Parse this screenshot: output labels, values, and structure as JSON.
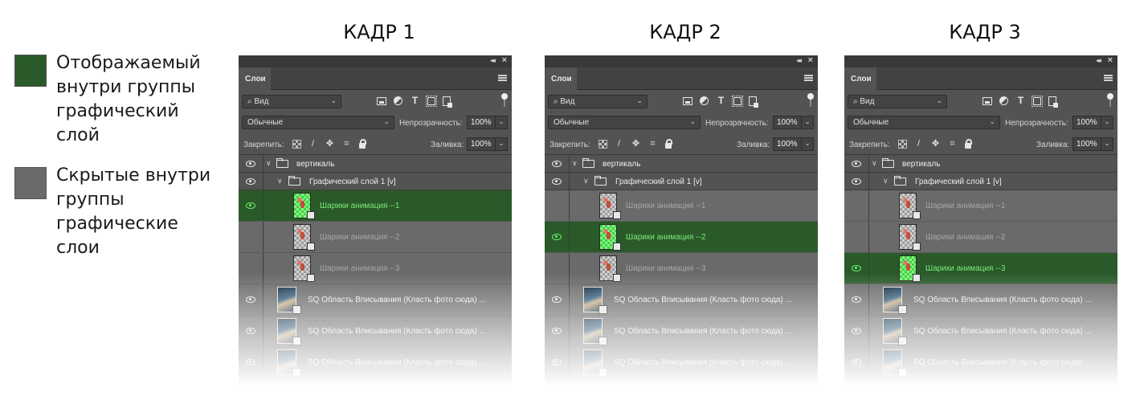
{
  "legend": {
    "items": [
      {
        "color": "#2a5a2a",
        "text": "Отображаемый внутри группы графический слой"
      },
      {
        "color": "#6a6a6a",
        "text": "Скрытые внутри группы графические слои"
      }
    ]
  },
  "frames": [
    {
      "title": "КАДР 1",
      "panel": {
        "tab": "Слои",
        "filter": "Вид",
        "blend": "Обычные",
        "opacity_label": "Непрозрачность:",
        "opacity": "100%",
        "lock_label": "Закрепить:",
        "fill_label": "Заливка:",
        "fill": "100%",
        "group_name": "вертикаль",
        "subgroup_name": "Графический слой 1 [v]",
        "layers": [
          "Шарики анимация --1",
          "Шарики анимация --2",
          "Шарики анимация --3"
        ],
        "visible_index": 0,
        "photo_layers": [
          "SQ Область Вписывания (Класть фото сюда) ...",
          "SQ Область Вписывания (Класть фото сюда) ...",
          "SQ Область Вписывания (Класть фото сюда) ..."
        ]
      }
    },
    {
      "title": "КАДР 2",
      "panel": {
        "tab": "Слои",
        "filter": "Вид",
        "blend": "Обычные",
        "opacity_label": "Непрозрачность:",
        "opacity": "100%",
        "lock_label": "Закрепить:",
        "fill_label": "Заливка:",
        "fill": "100%",
        "group_name": "вертикаль",
        "subgroup_name": "Графический слой 1 [v]",
        "layers": [
          "Шарики анимация --1",
          "Шарики анимация --2",
          "Шарики анимация --3"
        ],
        "visible_index": 1,
        "photo_layers": [
          "SQ Область Вписывания (Класть фото сюда) ...",
          "SQ Область Вписывания (Класть фото сюда) ...",
          "SQ Область Вписывания (Класть фото сюда) ..."
        ]
      }
    },
    {
      "title": "КАДР 3",
      "panel": {
        "tab": "Слои",
        "filter": "Вид",
        "blend": "Обычные",
        "opacity_label": "Непрозрачность:",
        "opacity": "100%",
        "lock_label": "Закрепить:",
        "fill_label": "Заливка:",
        "fill": "100%",
        "group_name": "вертикаль",
        "subgroup_name": "Графический слой 1 [v]",
        "layers": [
          "Шарики анимация --1",
          "Шарики анимация --2",
          "Шарики анимация --3"
        ],
        "visible_index": 2,
        "photo_layers": [
          "SQ Область Вписывания (Класть фото сюда) ...",
          "SQ Область Вписывания (Класть фото сюда) ...",
          "SQ Область Вписывания (Класть фото сюда) ..."
        ]
      }
    }
  ],
  "icons": {
    "panel_collapse": "double-chevron-left-icon",
    "panel_close": "close-icon",
    "panel_menu": "hamburger-menu-icon",
    "eye": "eye-icon",
    "folder": "folder-icon",
    "search": "search-icon",
    "lock": "lock-icon"
  },
  "colors": {
    "visible_layer": "#2a5a2a",
    "visible_text": "#7bea7b",
    "hidden_layer": "#6a6a6a",
    "panel_bg": "#535353"
  }
}
